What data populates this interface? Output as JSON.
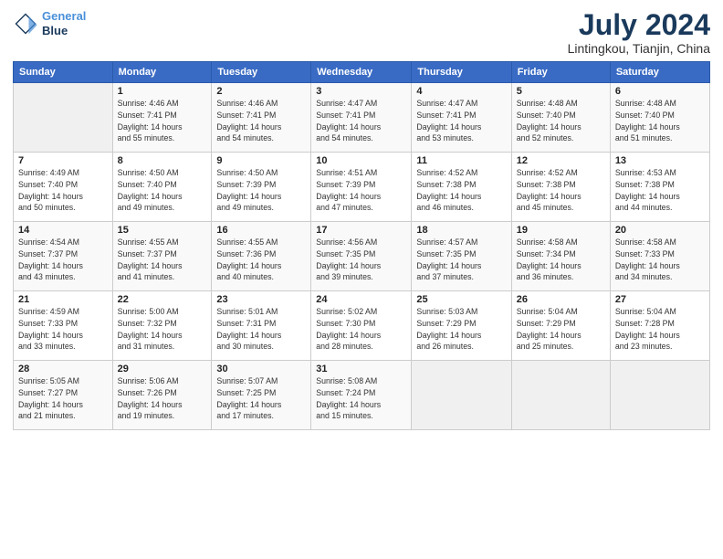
{
  "logo": {
    "line1": "General",
    "line2": "Blue"
  },
  "title": "July 2024",
  "subtitle": "Lintingkou, Tianjin, China",
  "weekdays": [
    "Sunday",
    "Monday",
    "Tuesday",
    "Wednesday",
    "Thursday",
    "Friday",
    "Saturday"
  ],
  "weeks": [
    [
      {
        "day": "",
        "info": ""
      },
      {
        "day": "1",
        "info": "Sunrise: 4:46 AM\nSunset: 7:41 PM\nDaylight: 14 hours\nand 55 minutes."
      },
      {
        "day": "2",
        "info": "Sunrise: 4:46 AM\nSunset: 7:41 PM\nDaylight: 14 hours\nand 54 minutes."
      },
      {
        "day": "3",
        "info": "Sunrise: 4:47 AM\nSunset: 7:41 PM\nDaylight: 14 hours\nand 54 minutes."
      },
      {
        "day": "4",
        "info": "Sunrise: 4:47 AM\nSunset: 7:41 PM\nDaylight: 14 hours\nand 53 minutes."
      },
      {
        "day": "5",
        "info": "Sunrise: 4:48 AM\nSunset: 7:40 PM\nDaylight: 14 hours\nand 52 minutes."
      },
      {
        "day": "6",
        "info": "Sunrise: 4:48 AM\nSunset: 7:40 PM\nDaylight: 14 hours\nand 51 minutes."
      }
    ],
    [
      {
        "day": "7",
        "info": "Sunrise: 4:49 AM\nSunset: 7:40 PM\nDaylight: 14 hours\nand 50 minutes."
      },
      {
        "day": "8",
        "info": "Sunrise: 4:50 AM\nSunset: 7:40 PM\nDaylight: 14 hours\nand 49 minutes."
      },
      {
        "day": "9",
        "info": "Sunrise: 4:50 AM\nSunset: 7:39 PM\nDaylight: 14 hours\nand 49 minutes."
      },
      {
        "day": "10",
        "info": "Sunrise: 4:51 AM\nSunset: 7:39 PM\nDaylight: 14 hours\nand 47 minutes."
      },
      {
        "day": "11",
        "info": "Sunrise: 4:52 AM\nSunset: 7:38 PM\nDaylight: 14 hours\nand 46 minutes."
      },
      {
        "day": "12",
        "info": "Sunrise: 4:52 AM\nSunset: 7:38 PM\nDaylight: 14 hours\nand 45 minutes."
      },
      {
        "day": "13",
        "info": "Sunrise: 4:53 AM\nSunset: 7:38 PM\nDaylight: 14 hours\nand 44 minutes."
      }
    ],
    [
      {
        "day": "14",
        "info": "Sunrise: 4:54 AM\nSunset: 7:37 PM\nDaylight: 14 hours\nand 43 minutes."
      },
      {
        "day": "15",
        "info": "Sunrise: 4:55 AM\nSunset: 7:37 PM\nDaylight: 14 hours\nand 41 minutes."
      },
      {
        "day": "16",
        "info": "Sunrise: 4:55 AM\nSunset: 7:36 PM\nDaylight: 14 hours\nand 40 minutes."
      },
      {
        "day": "17",
        "info": "Sunrise: 4:56 AM\nSunset: 7:35 PM\nDaylight: 14 hours\nand 39 minutes."
      },
      {
        "day": "18",
        "info": "Sunrise: 4:57 AM\nSunset: 7:35 PM\nDaylight: 14 hours\nand 37 minutes."
      },
      {
        "day": "19",
        "info": "Sunrise: 4:58 AM\nSunset: 7:34 PM\nDaylight: 14 hours\nand 36 minutes."
      },
      {
        "day": "20",
        "info": "Sunrise: 4:58 AM\nSunset: 7:33 PM\nDaylight: 14 hours\nand 34 minutes."
      }
    ],
    [
      {
        "day": "21",
        "info": "Sunrise: 4:59 AM\nSunset: 7:33 PM\nDaylight: 14 hours\nand 33 minutes."
      },
      {
        "day": "22",
        "info": "Sunrise: 5:00 AM\nSunset: 7:32 PM\nDaylight: 14 hours\nand 31 minutes."
      },
      {
        "day": "23",
        "info": "Sunrise: 5:01 AM\nSunset: 7:31 PM\nDaylight: 14 hours\nand 30 minutes."
      },
      {
        "day": "24",
        "info": "Sunrise: 5:02 AM\nSunset: 7:30 PM\nDaylight: 14 hours\nand 28 minutes."
      },
      {
        "day": "25",
        "info": "Sunrise: 5:03 AM\nSunset: 7:29 PM\nDaylight: 14 hours\nand 26 minutes."
      },
      {
        "day": "26",
        "info": "Sunrise: 5:04 AM\nSunset: 7:29 PM\nDaylight: 14 hours\nand 25 minutes."
      },
      {
        "day": "27",
        "info": "Sunrise: 5:04 AM\nSunset: 7:28 PM\nDaylight: 14 hours\nand 23 minutes."
      }
    ],
    [
      {
        "day": "28",
        "info": "Sunrise: 5:05 AM\nSunset: 7:27 PM\nDaylight: 14 hours\nand 21 minutes."
      },
      {
        "day": "29",
        "info": "Sunrise: 5:06 AM\nSunset: 7:26 PM\nDaylight: 14 hours\nand 19 minutes."
      },
      {
        "day": "30",
        "info": "Sunrise: 5:07 AM\nSunset: 7:25 PM\nDaylight: 14 hours\nand 17 minutes."
      },
      {
        "day": "31",
        "info": "Sunrise: 5:08 AM\nSunset: 7:24 PM\nDaylight: 14 hours\nand 15 minutes."
      },
      {
        "day": "",
        "info": ""
      },
      {
        "day": "",
        "info": ""
      },
      {
        "day": "",
        "info": ""
      }
    ]
  ]
}
